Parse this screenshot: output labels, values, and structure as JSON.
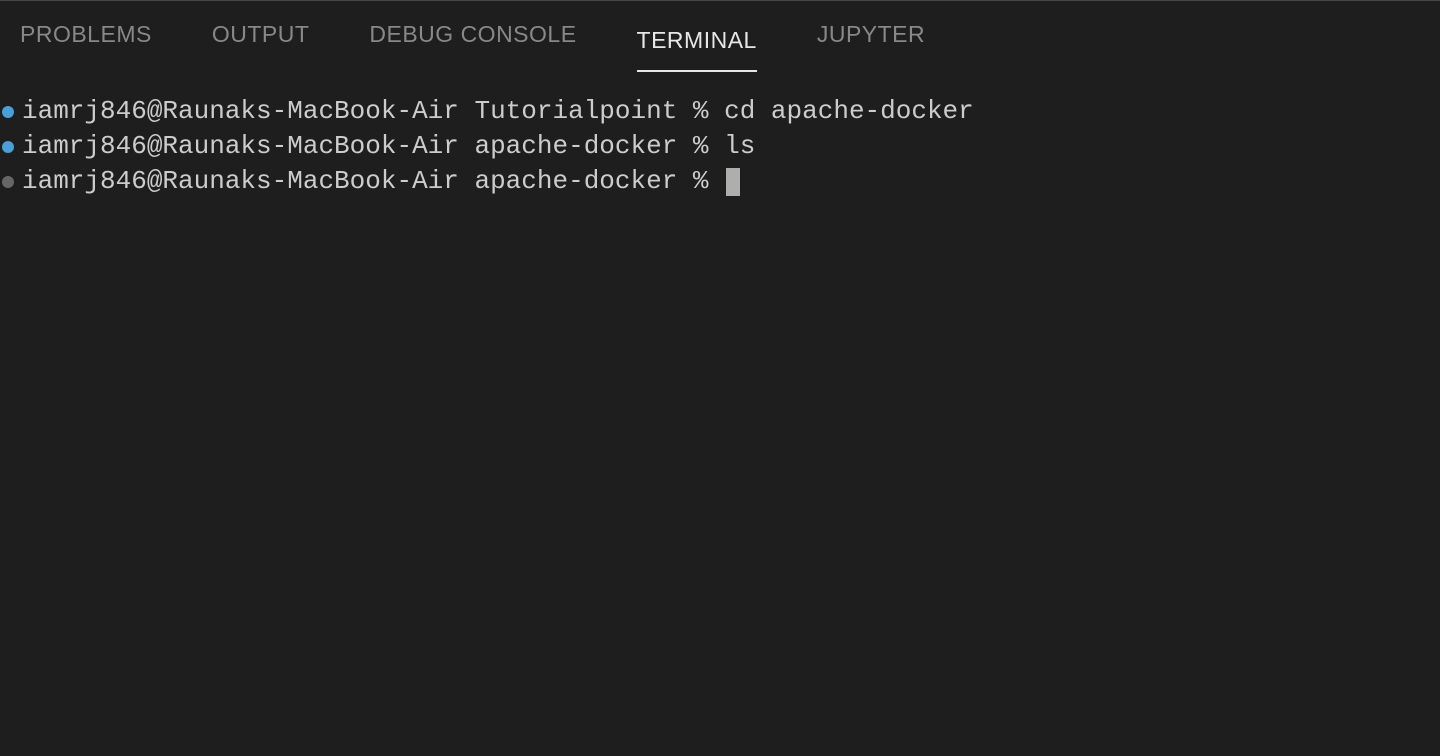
{
  "tabs": {
    "problems": "PROBLEMS",
    "output": "OUTPUT",
    "debug_console": "DEBUG CONSOLE",
    "terminal": "TERMINAL",
    "jupyter": "JUPYTER"
  },
  "terminal": {
    "lines": [
      {
        "marker": "blue",
        "prompt": "iamrj846@Raunaks-MacBook-Air Tutorialpoint % ",
        "command": "cd apache-docker"
      },
      {
        "marker": "blue",
        "prompt": "iamrj846@Raunaks-MacBook-Air apache-docker % ",
        "command": "ls"
      },
      {
        "marker": "gray",
        "prompt": "iamrj846@Raunaks-MacBook-Air apache-docker % ",
        "command": ""
      }
    ]
  }
}
